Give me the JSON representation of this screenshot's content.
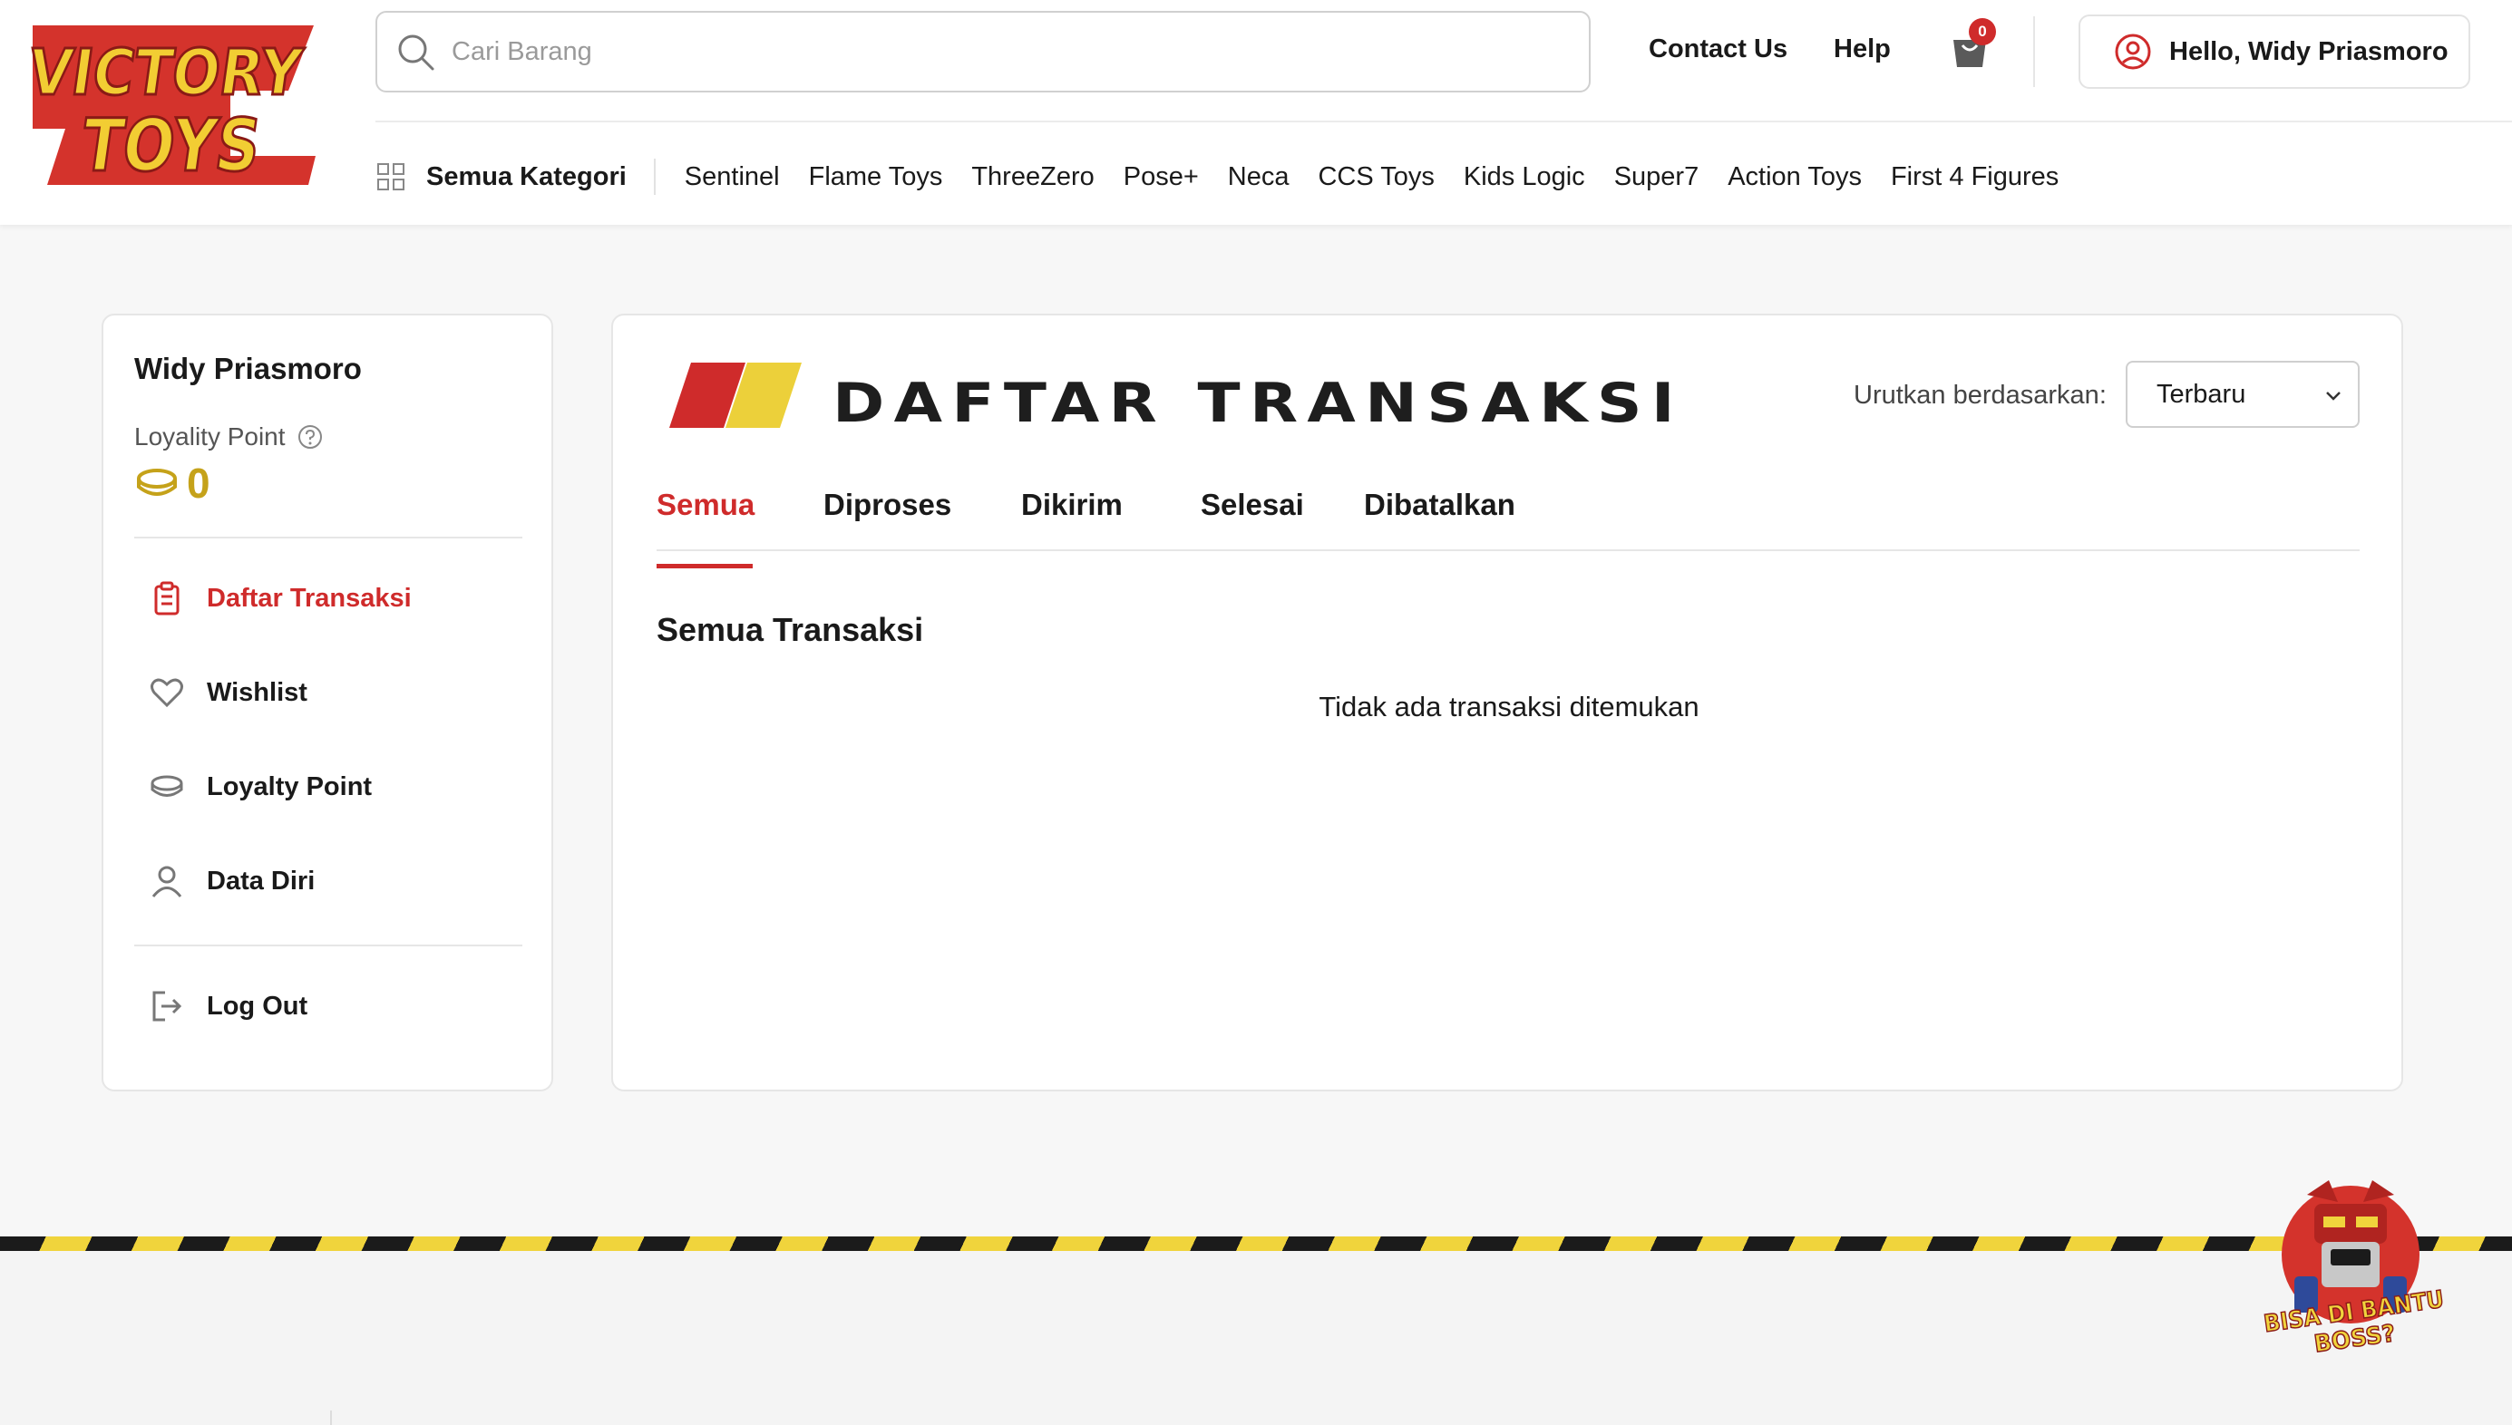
{
  "brand": {
    "logo_line1": "VICTORY",
    "logo_line2": "TOYS"
  },
  "header": {
    "search_placeholder": "Cari Barang",
    "contact_label": "Contact Us",
    "help_label": "Help",
    "cart_count": "0",
    "user_greeting": "Hello, Widy Priasmoro"
  },
  "categories": {
    "all_label": "Semua Kategori",
    "items": [
      "Sentinel",
      "Flame Toys",
      "ThreeZero",
      "Pose+",
      "Neca",
      "CCS Toys",
      "Kids Logic",
      "Super7",
      "Action Toys",
      "First 4 Figures"
    ]
  },
  "sidebar": {
    "user_name": "Widy Priasmoro",
    "loyalty_label": "Loyality Point",
    "loyalty_value": "0",
    "menu": [
      {
        "label": "Daftar Transaksi",
        "icon": "clipboard-icon",
        "active": true
      },
      {
        "label": "Wishlist",
        "icon": "heart-icon",
        "active": false
      },
      {
        "label": "Loyalty Point",
        "icon": "coin-icon",
        "active": false
      },
      {
        "label": "Data Diri",
        "icon": "user-icon",
        "active": false
      }
    ],
    "logout_label": "Log Out"
  },
  "main": {
    "title": "DAFTAR TRANSAKSI",
    "sort_label": "Urutkan berdasarkan:",
    "sort_value": "Terbaru",
    "tabs": [
      "Semua",
      "Diproses",
      "Dikirim",
      "Selesai",
      "Dibatalkan"
    ],
    "active_tab": 0,
    "section_title": "Semua Transaksi",
    "empty_message": "Tidak ada transaksi ditemukan"
  },
  "mascot": {
    "line1": "BISA DI BANTU",
    "line2": "BOSS?"
  },
  "colors": {
    "accent_red": "#cf2b2b",
    "accent_yellow": "#f0d43c",
    "coin_gold": "#c5a21a",
    "hazard_black": "#1b1b1b"
  }
}
